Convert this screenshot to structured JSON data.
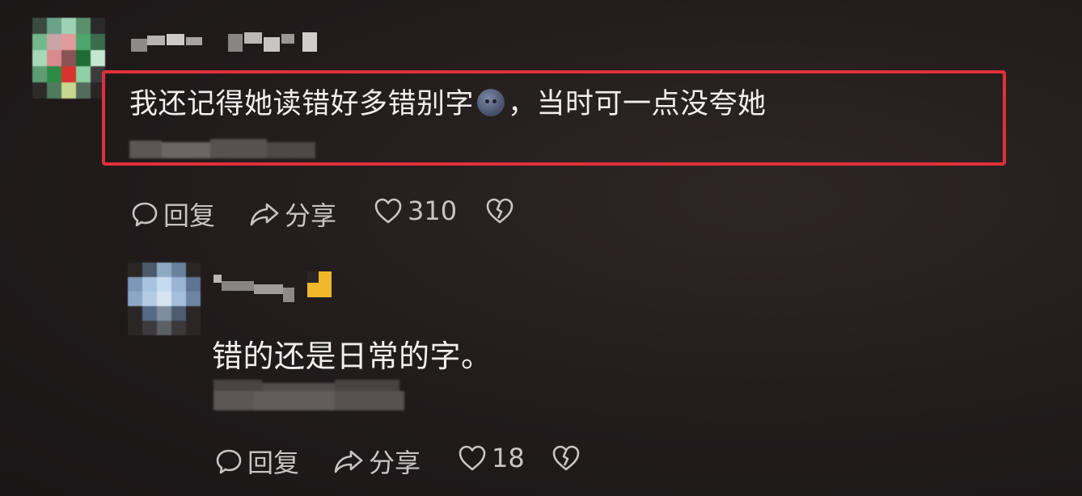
{
  "comments": [
    {
      "text_before_emoji": "我还记得她读错好多错别字",
      "emoji_icon": "smiling-face-emoji",
      "text_after_emoji": "，当时可一点没夸她",
      "actions": {
        "reply_label": "回复",
        "share_label": "分享",
        "like_count": "310"
      },
      "highlight_color": "#e0303a"
    },
    {
      "text": "错的还是日常的字。",
      "actions": {
        "reply_label": "回复",
        "share_label": "分享",
        "like_count": "18"
      }
    }
  ],
  "colors": {
    "background": "#211b1c",
    "text": "#f1eeee",
    "action_text": "#c9c4c4",
    "badge": "#f2b82c"
  }
}
